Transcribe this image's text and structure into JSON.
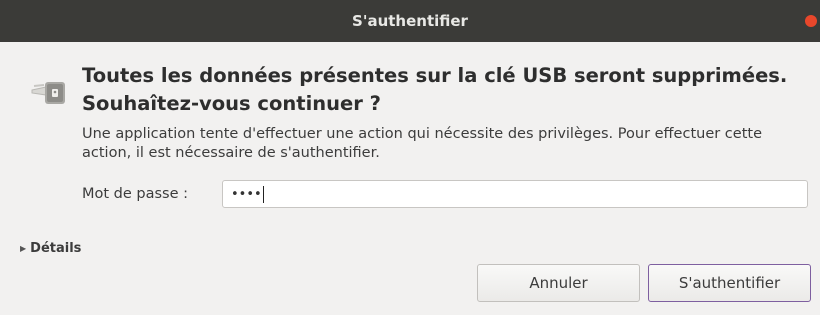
{
  "window": {
    "title": "S'authentifier"
  },
  "dialog": {
    "headline": "Toutes les données présentes sur la clé USB seront supprimées. Souhaîtez-vous continuer ?",
    "description": "Une application tente d'effectuer une action qui nécessite des privilèges. Pour effectuer cette action, il est nécessaire de s'authentifier.",
    "password_label": "Mot de passe :",
    "password_value": "••••",
    "details_label": "Détails",
    "cancel_label": "Annuler",
    "authenticate_label": "S'authentifier"
  },
  "colors": {
    "titlebar": "#3b3b38",
    "close_button": "#e8472b",
    "default_button_border": "#7e5fa0"
  },
  "icons": {
    "dialog": "padlock-key-icon",
    "details": "disclosure-triangle-icon"
  }
}
